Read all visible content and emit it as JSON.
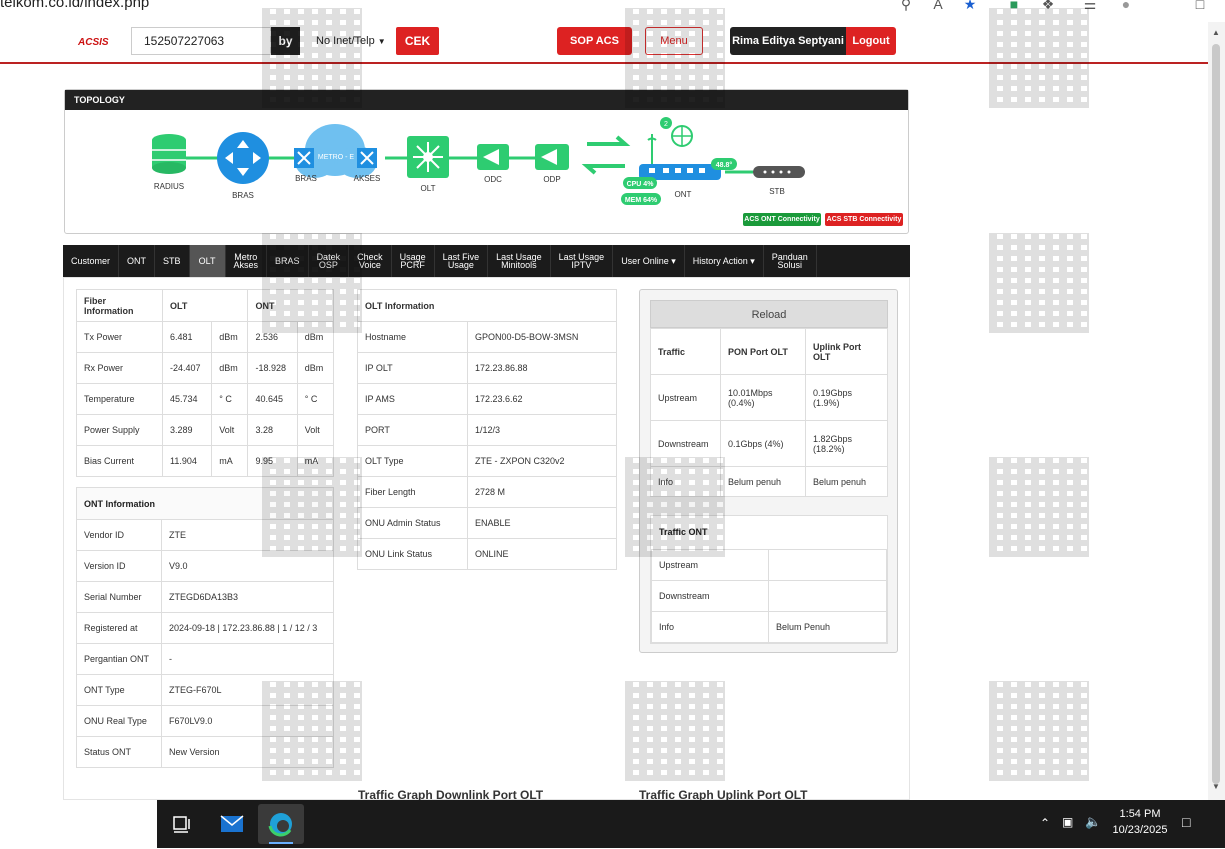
{
  "browser": {
    "url": "telkom.co.id/index.php"
  },
  "header": {
    "logo": "ACSIS",
    "search_value": "152507227063",
    "by_label": "by",
    "search_type": "No Inet/Telp",
    "cek_label": "CEK",
    "sop_label": "SOP ACS",
    "menu_label": "Menu",
    "user_name": "Rima Editya Septyani",
    "logout_label": "Logout"
  },
  "topology": {
    "title": "TOPOLOGY",
    "nodes": [
      "RADIUS",
      "BRAS",
      "BRAS",
      "METRO - E",
      "AKSES",
      "OLT",
      "ODC",
      "ODP",
      "ONT",
      "STB"
    ],
    "badge_count": "2",
    "cpu": "CPU 4%",
    "mem": "MEM 64%",
    "temp": "48.8°",
    "legend_ont": "ACS ONT Connectivity",
    "legend_stb": "ACS STB Connectivity"
  },
  "tabs": [
    {
      "l1": "Customer",
      "l2": ""
    },
    {
      "l1": "ONT",
      "l2": ""
    },
    {
      "l1": "STB",
      "l2": ""
    },
    {
      "l1": "OLT",
      "l2": ""
    },
    {
      "l1": "Metro",
      "l2": "Akses"
    },
    {
      "l1": "BRAS",
      "l2": ""
    },
    {
      "l1": "Datek",
      "l2": "OSP"
    },
    {
      "l1": "Check",
      "l2": "Voice"
    },
    {
      "l1": "Usage",
      "l2": "PCRF"
    },
    {
      "l1": "Last Five",
      "l2": "Usage"
    },
    {
      "l1": "Last Usage",
      "l2": "Minitools"
    },
    {
      "l1": "Last Usage",
      "l2": "IPTV"
    },
    {
      "l1": "User Online ▾",
      "l2": ""
    },
    {
      "l1": "History Action ▾",
      "l2": ""
    },
    {
      "l1": "Panduan",
      "l2": "Solusi"
    }
  ],
  "fiber": {
    "headers": [
      "Fiber Information",
      "OLT",
      "ONT"
    ],
    "rows": [
      [
        "Tx Power",
        "6.481",
        "dBm",
        "2.536",
        "dBm"
      ],
      [
        "Rx Power",
        "-24.407",
        "dBm",
        "-18.928",
        "dBm"
      ],
      [
        "Temperature",
        "45.734",
        "° C",
        "40.645",
        "° C"
      ],
      [
        "Power Supply",
        "3.289",
        "Volt",
        "3.28",
        "Volt"
      ],
      [
        "Bias Current",
        "11.904",
        "mA",
        "9.95",
        "mA"
      ]
    ]
  },
  "ont_info": {
    "title": "ONT Information",
    "rows": [
      [
        "Vendor ID",
        "ZTE"
      ],
      [
        "Version ID",
        "V9.0"
      ],
      [
        "Serial Number",
        "ZTEGD6DA13B3"
      ],
      [
        "Registered at",
        "2024-09-18 | 172.23.86.88 | 1 / 12 / 3"
      ],
      [
        "Pergantian ONT",
        "-"
      ],
      [
        "ONT Type",
        "ZTEG-F670L"
      ],
      [
        "ONU Real Type",
        "F670LV9.0"
      ],
      [
        "Status ONT",
        "New Version"
      ]
    ]
  },
  "olt_info": {
    "title": "OLT Information",
    "rows": [
      [
        "Hostname",
        "GPON00-D5-BOW-3MSN"
      ],
      [
        "IP OLT",
        "172.23.86.88"
      ],
      [
        "IP AMS",
        "172.23.6.62"
      ],
      [
        "PORT",
        "1/12/3"
      ],
      [
        "OLT Type",
        "ZTE - ZXPON C320v2"
      ],
      [
        "Fiber Length",
        "2728 M"
      ],
      [
        "ONU Admin Status",
        "ENABLE"
      ],
      [
        "ONU Link Status",
        "ONLINE"
      ]
    ]
  },
  "traffic": {
    "reload_label": "Reload",
    "headers": [
      "Traffic",
      "PON Port OLT",
      "Uplink Port OLT"
    ],
    "rows": [
      [
        "Upstream",
        "10.01Mbps (0.4%)",
        "0.19Gbps (1.9%)"
      ],
      [
        "Downstream",
        "0.1Gbps (4%)",
        "1.82Gbps (18.2%)"
      ],
      [
        "Info",
        "Belum penuh",
        "Belum penuh"
      ]
    ]
  },
  "traffic_ont": {
    "title": "Traffic ONT",
    "rows": [
      [
        "Upstream",
        ""
      ],
      [
        "Downstream",
        ""
      ],
      [
        "Info",
        "Belum Penuh"
      ]
    ]
  },
  "graphs": {
    "downlink": "Traffic Graph Downlink Port OLT",
    "uplink": "Traffic Graph Uplink Port OLT"
  },
  "taskbar": {
    "time": "1:54 PM",
    "date": "10/23/2025"
  },
  "colors": {
    "accent": "#dd2222",
    "dark": "#1b1b1b",
    "green": "#2ecc71"
  }
}
